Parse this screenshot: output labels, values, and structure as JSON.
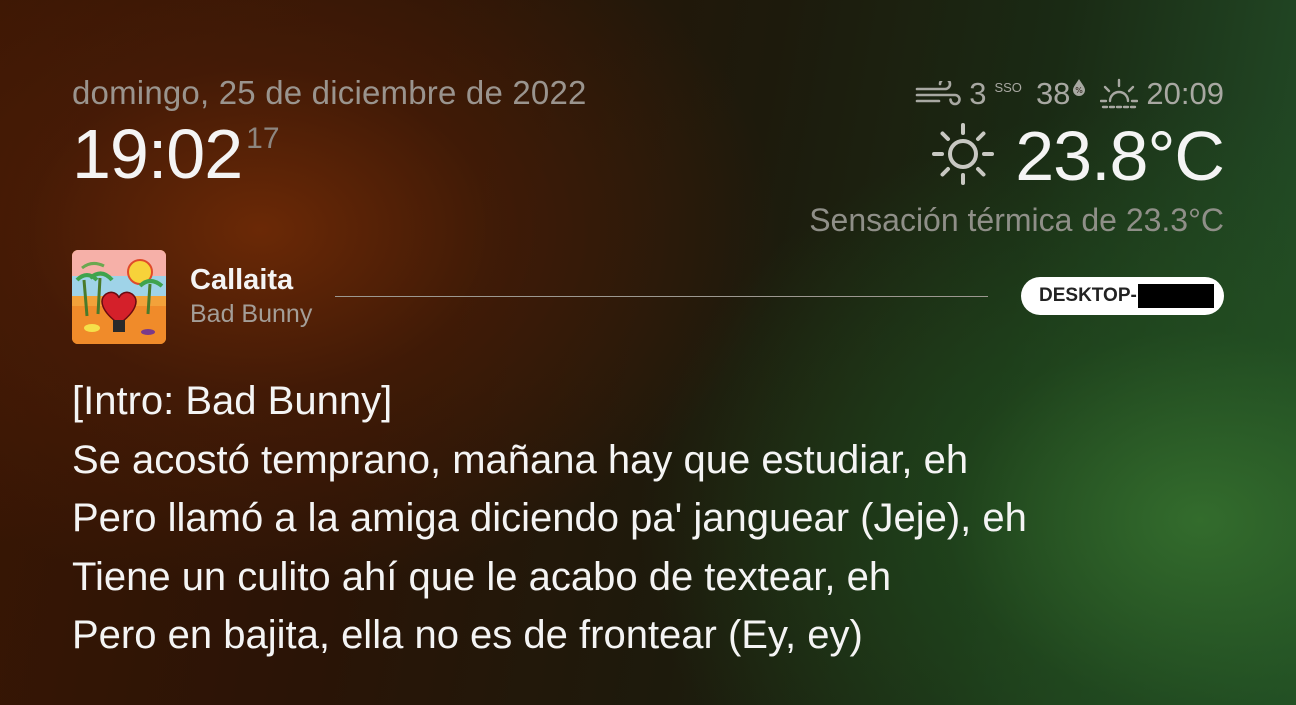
{
  "clock": {
    "date": "domingo, 25 de diciembre de 2022",
    "time_hm": "19:02",
    "time_seconds": "17"
  },
  "weather": {
    "wind_speed": "3",
    "wind_direction": "SSO",
    "humidity": "38",
    "sunset_time": "20:09",
    "temperature": "23.8°C",
    "feels_like": "Sensación térmica de 23.3°C",
    "icons": {
      "wind": "wind-icon",
      "humidity": "humidity-drop-icon",
      "sunset": "sunset-icon",
      "condition": "sun-icon"
    }
  },
  "now_playing": {
    "title": "Callaita",
    "artist": "Bad Bunny",
    "device_label": "DESKTOP-",
    "device_name_redacted": true
  },
  "lyrics": [
    "[Intro: Bad Bunny]",
    "Se acostó temprano, mañana hay que estudiar, eh",
    "Pero llamó a la amiga diciendo pa' janguear (Jeje), eh",
    "Tiene un culito ahí que le acabo de textear, eh",
    "Pero en bajita, ella no es de frontear (Ey, ey)"
  ],
  "colors": {
    "background_warm": "#3a1604",
    "background_green": "#24522a",
    "text_primary": "#f4f4f4",
    "text_secondary": "#9a948e",
    "pill_background": "#ffffff"
  }
}
